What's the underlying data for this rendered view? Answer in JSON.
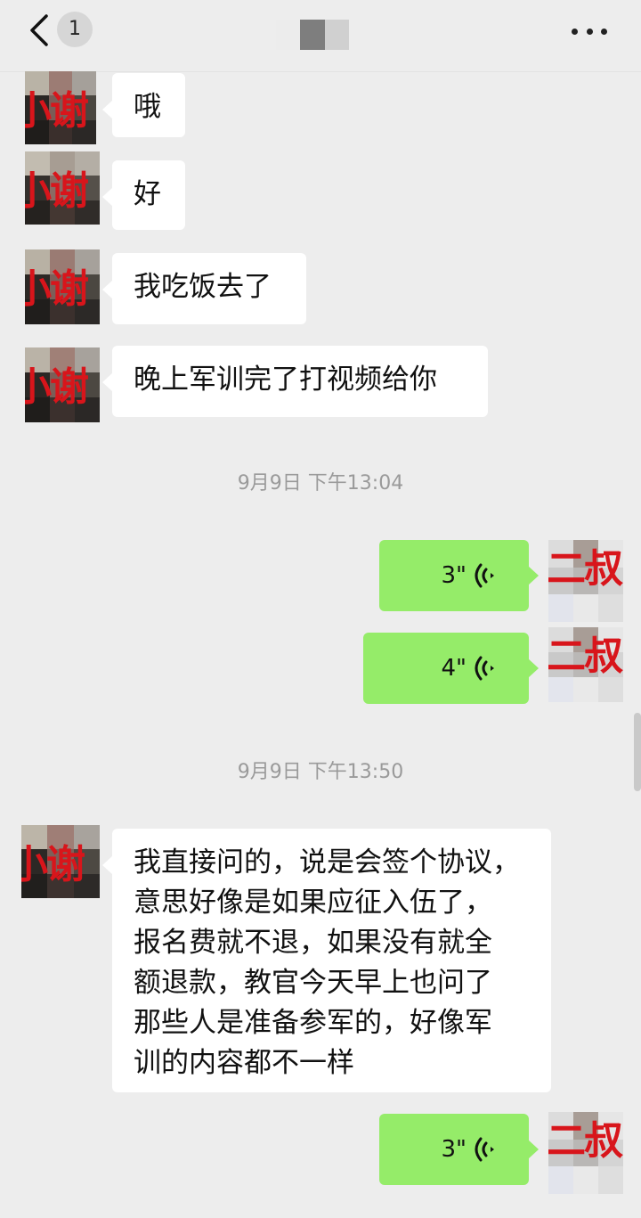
{
  "header": {
    "unread_count": "1"
  },
  "contacts": {
    "left_name": "小谢",
    "right_name": "二叔"
  },
  "messages": {
    "m1": "哦",
    "m2": "好",
    "m3": "我吃饭去了",
    "m4": "晚上军训完了打视频给你",
    "ts1": "9月9日 下午13:04",
    "voice1": "3\"",
    "voice2": "4\"",
    "ts2": "9月9日 下午13:50",
    "m5": "我直接问的，说是会签个协议，\n意思好像是如果应征入伍了，\n报名费就不退，如果没有就全\n额退款，教官今天早上也问了\n那些人是准备参军的，好像军\n训的内容都不一样",
    "voice3": "3\""
  },
  "icons": {
    "back": "chevron-left-icon",
    "more": "more-dots-icon",
    "voice": "voice-wave-icon"
  },
  "colors": {
    "background": "#ededed",
    "voice_bubble": "#95ec69",
    "text_bubble": "#ffffff",
    "name_tag": "#d8151b"
  }
}
